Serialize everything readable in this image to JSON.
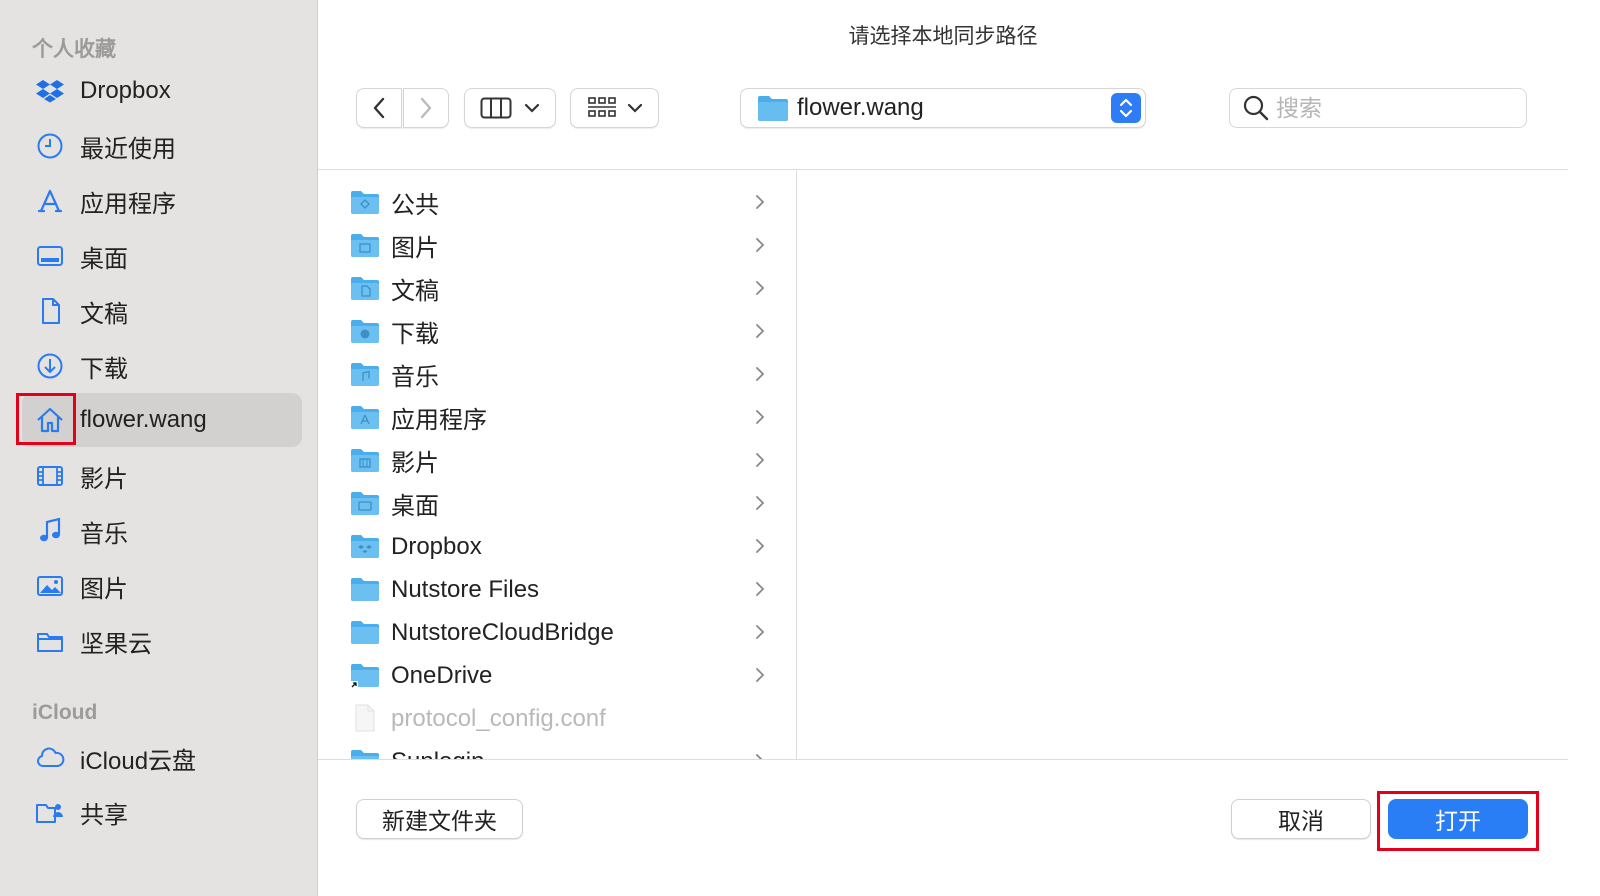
{
  "dialog": {
    "title": "请选择本地同步路径"
  },
  "sidebar": {
    "favorites_header": "个人收藏",
    "favorites": [
      {
        "label": "Dropbox",
        "icon": "dropbox-icon"
      },
      {
        "label": "最近使用",
        "icon": "clock-icon"
      },
      {
        "label": "应用程序",
        "icon": "applications-icon"
      },
      {
        "label": "桌面",
        "icon": "desktop-icon"
      },
      {
        "label": "文稿",
        "icon": "document-icon"
      },
      {
        "label": "下载",
        "icon": "download-icon"
      },
      {
        "label": "flower.wang",
        "icon": "home-icon",
        "selected": true
      },
      {
        "label": "影片",
        "icon": "film-icon"
      },
      {
        "label": "音乐",
        "icon": "music-note-icon"
      },
      {
        "label": "图片",
        "icon": "photo-icon"
      },
      {
        "label": "坚果云",
        "icon": "folder-icon"
      }
    ],
    "icloud_header": "iCloud",
    "icloud": [
      {
        "label": "iCloud云盘",
        "icon": "cloud-icon"
      },
      {
        "label": "共享",
        "icon": "shared-folder-icon"
      }
    ]
  },
  "toolbar": {
    "current_folder": "flower.wang",
    "search_placeholder": "搜索"
  },
  "files": [
    {
      "name": "公共",
      "type": "folder",
      "badge": "public"
    },
    {
      "name": "图片",
      "type": "folder",
      "badge": "photo"
    },
    {
      "name": "文稿",
      "type": "folder",
      "badge": "doc"
    },
    {
      "name": "下载",
      "type": "folder",
      "badge": "download"
    },
    {
      "name": "音乐",
      "type": "folder",
      "badge": "music"
    },
    {
      "name": "应用程序",
      "type": "folder",
      "badge": "apps"
    },
    {
      "name": "影片",
      "type": "folder",
      "badge": "film"
    },
    {
      "name": "桌面",
      "type": "folder",
      "badge": "desktop"
    },
    {
      "name": "Dropbox",
      "type": "folder",
      "badge": "dropbox"
    },
    {
      "name": "Nutstore Files",
      "type": "folder",
      "badge": ""
    },
    {
      "name": "NutstoreCloudBridge",
      "type": "folder",
      "badge": ""
    },
    {
      "name": "OneDrive",
      "type": "folder",
      "badge": "alias"
    },
    {
      "name": "protocol_config.conf",
      "type": "file",
      "disabled": true
    },
    {
      "name": "Sunlogin",
      "type": "folder",
      "badge": ""
    }
  ],
  "buttons": {
    "new_folder": "新建文件夹",
    "cancel": "取消",
    "open": "打开"
  },
  "colors": {
    "accent": "#2a7ef5",
    "folder": "#5fb7ee",
    "highlight": "#e3001b"
  }
}
